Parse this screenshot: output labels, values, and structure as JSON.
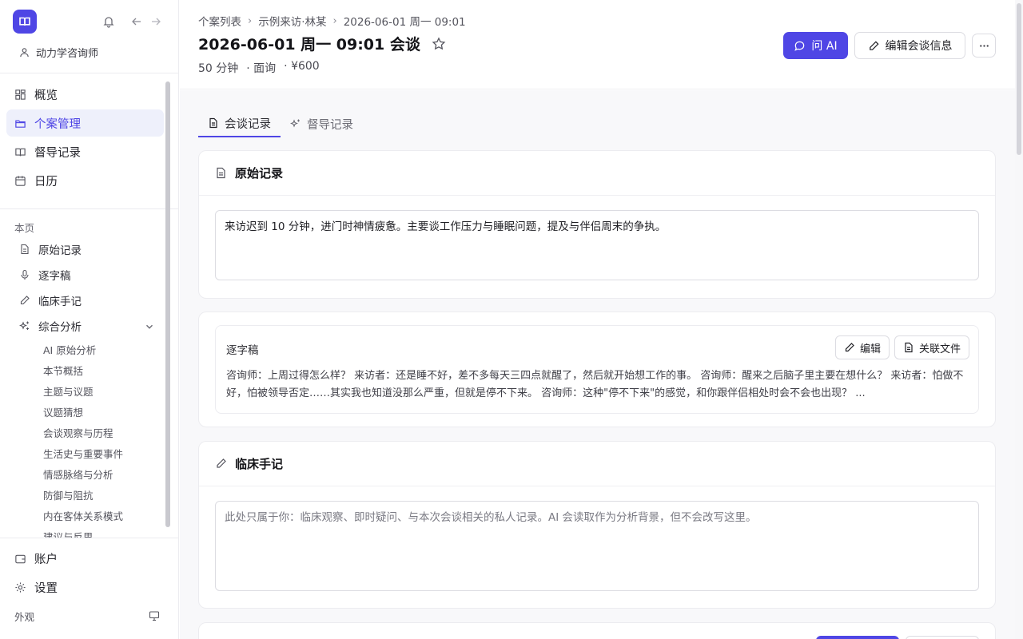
{
  "sidebar": {
    "role": "动力学咨询师",
    "nav": [
      {
        "label": "概览",
        "icon": "grid-icon"
      },
      {
        "label": "个案管理",
        "icon": "folder-icon"
      },
      {
        "label": "督导记录",
        "icon": "book-icon"
      },
      {
        "label": "日历",
        "icon": "calendar-icon"
      }
    ],
    "section_label": "本页",
    "page_nav": [
      {
        "label": "原始记录",
        "icon": "file-icon"
      },
      {
        "label": "逐字稿",
        "icon": "mic-icon"
      },
      {
        "label": "临床手记",
        "icon": "pen-icon"
      },
      {
        "label": "综合分析",
        "icon": "sparkle-icon"
      }
    ],
    "sub_items": [
      "AI 原始分析",
      "本节概括",
      "主题与议题",
      "议题猜想",
      "会谈观察与历程",
      "生活史与重要事件",
      "情感脉络与分析",
      "防御与阻抗",
      "内在客体关系模式",
      "建议与反思"
    ],
    "account": "账户",
    "settings": "设置",
    "appearance": "外观"
  },
  "header": {
    "breadcrumbs": [
      "个案列表",
      "示例来访·林某",
      "2026-06-01 周一 09:01"
    ],
    "title": "2026-06-01 周一 09:01 会谈",
    "meta": [
      "50 分钟",
      "· 面询",
      "· ¥600"
    ],
    "ask_ai": "问 AI",
    "edit_info": "编辑会谈信息"
  },
  "tabs": [
    {
      "label": "会谈记录",
      "active": true
    },
    {
      "label": "督导记录",
      "active": false
    }
  ],
  "raw_record": {
    "title": "原始记录",
    "text": "来访迟到 10 分钟，进门时神情疲惫。主要谈工作压力与睡眠问题，提及与伴侣周末的争执。"
  },
  "transcript": {
    "title": "逐字稿",
    "edit": "编辑",
    "link_file": "关联文件",
    "text": "咨询师：上周过得怎么样？ 来访者：还是睡不好，差不多每天三四点就醒了，然后就开始想工作的事。 咨询师：醒来之后脑子里主要在想什么？ 来访者：怕做不好，怕被领导否定……其实我也知道没那么严重，但就是停不下来。 咨询师：这种\"停不下来\"的感觉，和你跟伴侣相处时会不会也出现？ ..."
  },
  "clinical_notes": {
    "title": "临床手记",
    "placeholder": "此处只属于你：临床观察、即时疑问、与本次会谈相关的私人记录。AI 会读取作为分析背景，但不会改写这里。"
  },
  "colors": {
    "accent": "#4f46e5",
    "active_bg": "#eef0fb"
  }
}
